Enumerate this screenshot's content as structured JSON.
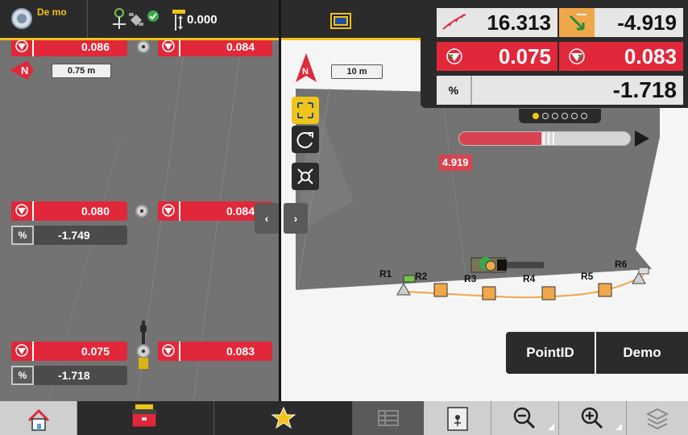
{
  "topbar": {
    "project_label": "De mo",
    "height_value": "0.000",
    "icons": [
      "project-logo-icon",
      "gnss-receiver-icon",
      "satellite-fixed-icon",
      "height-reference-icon",
      "screen-mode-icon"
    ]
  },
  "profile": {
    "scale_label": "0.75 m",
    "compass_label": "N",
    "rows": [
      {
        "left_value": "0.086",
        "right_value": "0.084"
      },
      {
        "left_value": "0.080",
        "right_value": "0.084",
        "slope": "-1.749"
      },
      {
        "left_value": "0.075",
        "right_value": "0.083",
        "slope": "-1.718"
      }
    ]
  },
  "map": {
    "north_label": "N",
    "scale_label": "10 m",
    "cut_value": "4.919",
    "cut_fraction": 0.48,
    "points": [
      "R1",
      "R2",
      "R3",
      "R4",
      "R5",
      "R6"
    ]
  },
  "readout": {
    "station_value": "16.313",
    "offset_value": "-4.919",
    "left_elev_value": "0.075",
    "right_elev_value": "0.083",
    "slope_label": "%",
    "slope_value": "-1.718",
    "page_dots": 6,
    "active_page": 1
  },
  "actions": {
    "pointid_label": "PointID",
    "demo_label": "Demo"
  },
  "nav": {
    "prev_arrow": "‹",
    "next_arrow": "›"
  },
  "colors": {
    "accent": "#f0c419",
    "cut_red": "#e0283a",
    "panel_dark": "#2b2b2b"
  }
}
